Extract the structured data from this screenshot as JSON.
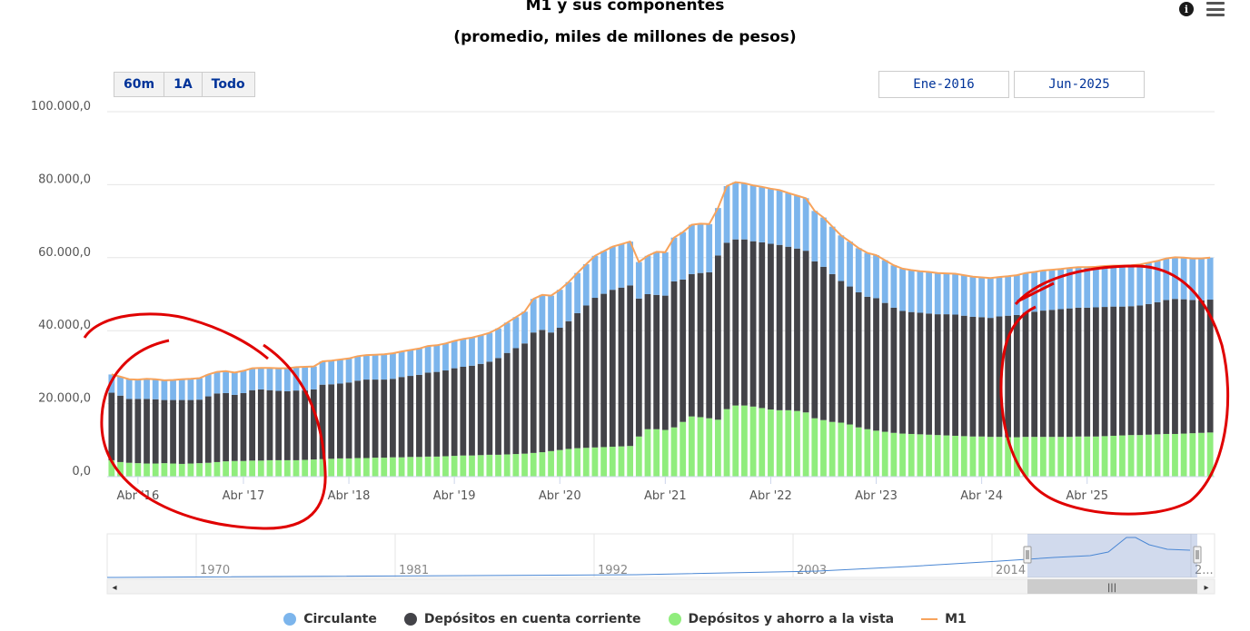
{
  "header": {
    "title": "M1 y sus componentes",
    "subtitle": "(promedio, miles de millones de pesos)"
  },
  "icons": {
    "info": "info-icon",
    "menu": "hamburger-menu-icon"
  },
  "range_selector": {
    "buttons": [
      "60m",
      "1A",
      "Todo"
    ],
    "from": "Ene-2016",
    "to": "Jun-2025"
  },
  "navigator": {
    "years": [
      "1970",
      "1981",
      "1992",
      "2003",
      "2014",
      "2..."
    ]
  },
  "colors": {
    "circulante": "#7cb5ec",
    "depositos_cc": "#434348",
    "depositos_ahorro": "#90ed7d",
    "m1": "#f7a35c",
    "annotation": "#e00000"
  },
  "legend": [
    "Circulante",
    "Depósitos en cuenta corriente",
    "Depósitos y ahorro a la vista",
    "M1"
  ],
  "chart_data": {
    "type": "bar",
    "stacked": true,
    "x_start": "Ene-2016",
    "x_end": "Jun-2025",
    "frequency": "monthly",
    "x_tick_labels": [
      "Abr '16",
      "Abr '17",
      "Abr '18",
      "Abr '19",
      "Abr '20",
      "Abr '21",
      "Abr '22",
      "Abr '23",
      "Abr '24",
      "Abr '25"
    ],
    "y_tick_labels": [
      "0,0",
      "20.000,0",
      "40.000,0",
      "60.000,0",
      "80.000,0",
      "100.000,0"
    ],
    "ylim": [
      0,
      100000
    ],
    "grid": true,
    "legend_position": "bottom",
    "series": [
      {
        "name": "Depósitos y ahorro a la vista",
        "stack_order": 0,
        "values": [
          4500,
          4000,
          3800,
          3700,
          3600,
          3600,
          3700,
          3600,
          3500,
          3600,
          3700,
          3800,
          4000,
          4200,
          4300,
          4300,
          4400,
          4400,
          4500,
          4500,
          4500,
          4500,
          4600,
          4700,
          4800,
          4900,
          5000,
          5000,
          5100,
          5100,
          5200,
          5200,
          5300,
          5300,
          5400,
          5400,
          5500,
          5500,
          5600,
          5700,
          5800,
          5800,
          5900,
          6000,
          6000,
          6100,
          6200,
          6300,
          6500,
          6700,
          7000,
          7300,
          7600,
          7800,
          7900,
          8000,
          8100,
          8200,
          8300,
          8400,
          11000,
          13000,
          13000,
          12800,
          13500,
          15000,
          16500,
          16300,
          16000,
          15600,
          18500,
          19500,
          19500,
          19200,
          18800,
          18400,
          18200,
          18200,
          18000,
          17600,
          16000,
          15500,
          15000,
          14800,
          14300,
          13500,
          13000,
          12600,
          12300,
          12000,
          11800,
          11700,
          11600,
          11500,
          11400,
          11300,
          11200,
          11100,
          11000,
          11000,
          10900,
          10900,
          10800,
          10800,
          10900,
          10900,
          10900,
          10900,
          10900,
          10900,
          11000,
          11000,
          11000,
          11100,
          11200,
          11300,
          11400,
          11400,
          11500,
          11600,
          11700,
          11700,
          11800,
          11900,
          12000,
          12100
        ]
      },
      {
        "name": "Depósitos en cuenta corriente",
        "stack_order": 1,
        "values": [
          18500,
          18200,
          17500,
          17600,
          17700,
          17600,
          17300,
          17400,
          17500,
          17400,
          17400,
          18200,
          18800,
          18700,
          18100,
          18600,
          19300,
          19500,
          19200,
          19000,
          18900,
          19100,
          19000,
          19200,
          20400,
          20400,
          20500,
          20800,
          21200,
          21500,
          21400,
          21400,
          21500,
          22000,
          22200,
          22500,
          23000,
          23200,
          23500,
          24000,
          24300,
          24600,
          25000,
          25500,
          26500,
          27800,
          29000,
          30200,
          33000,
          33500,
          32500,
          33500,
          35000,
          37000,
          39000,
          41000,
          42000,
          43000,
          43500,
          44000,
          37800,
          37000,
          36800,
          36800,
          40000,
          39000,
          39000,
          39500,
          40000,
          45000,
          45600,
          45500,
          45500,
          45300,
          45400,
          45400,
          45300,
          44800,
          44500,
          44300,
          43000,
          42000,
          40500,
          38800,
          37800,
          37000,
          36300,
          36300,
          35300,
          34300,
          33600,
          33400,
          33300,
          33200,
          33100,
          33200,
          33200,
          33000,
          32800,
          32700,
          32600,
          33000,
          33300,
          33500,
          34000,
          34300,
          34600,
          34800,
          35000,
          35200,
          35300,
          35300,
          35400,
          35400,
          35400,
          35300,
          35300,
          35500,
          35800,
          36200,
          36700,
          37000,
          36800,
          36500,
          36300,
          36400
        ]
      },
      {
        "name": "Circulante",
        "stack_order": 2,
        "values": [
          5000,
          5200,
          5400,
          5300,
          5500,
          5500,
          5400,
          5500,
          5700,
          5800,
          5900,
          6000,
          5900,
          6000,
          6100,
          6100,
          6000,
          5900,
          6100,
          6200,
          6300,
          6400,
          6500,
          6300,
          6400,
          6500,
          6600,
          6600,
          6700,
          6700,
          6800,
          6900,
          7000,
          7000,
          7100,
          7200,
          7300,
          7300,
          7400,
          7500,
          7600,
          7700,
          7800,
          7900,
          8100,
          8300,
          8500,
          8700,
          9200,
          9600,
          10100,
          10400,
          10700,
          11000,
          11300,
          11500,
          11700,
          11800,
          11900,
          12000,
          10000,
          10500,
          11800,
          11900,
          12000,
          13000,
          13500,
          13500,
          13200,
          13000,
          15500,
          15700,
          15400,
          15300,
          15200,
          15100,
          15000,
          14700,
          14500,
          14400,
          13800,
          13500,
          13000,
          12500,
          12300,
          12100,
          12000,
          11800,
          11700,
          11600,
          11600,
          11500,
          11400,
          11400,
          11300,
          11200,
          11200,
          11100,
          11000,
          10900,
          10900,
          10800,
          10800,
          10900,
          10900,
          10900,
          11000,
          11000,
          11000,
          11100,
          11100,
          11100,
          11100,
          11200,
          11200,
          11200,
          11200,
          11200,
          11300,
          11300,
          11400,
          11400,
          11400,
          11400,
          11500,
          11500
        ]
      },
      {
        "name": "M1",
        "type": "line",
        "values": "sum of the three stacked series per month"
      }
    ]
  }
}
